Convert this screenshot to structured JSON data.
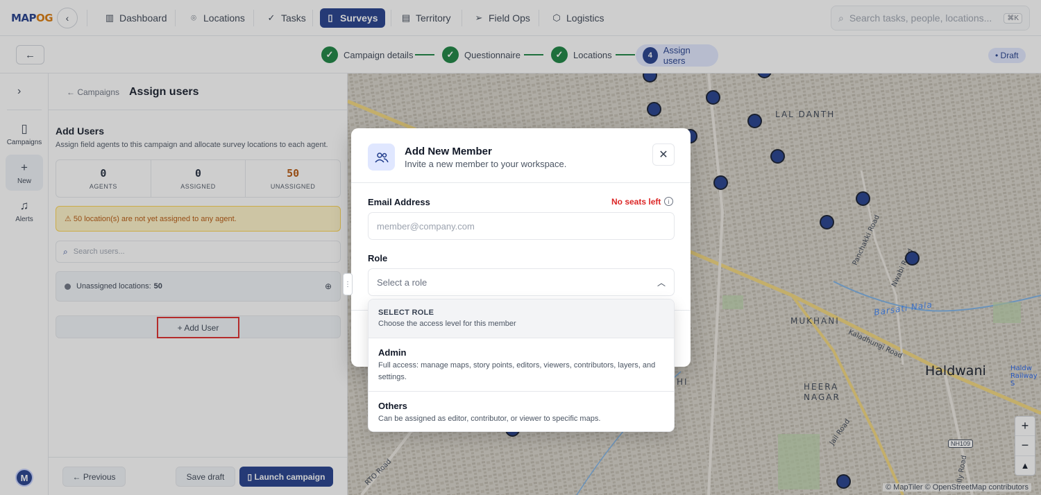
{
  "brand": {
    "logo_a": "MAP",
    "logo_b": "OG"
  },
  "nav": {
    "items": [
      {
        "label": "Dashboard",
        "icon": "bar-chart-icon"
      },
      {
        "label": "Locations",
        "icon": "map-pin-icon"
      },
      {
        "label": "Tasks",
        "icon": "check-icon"
      },
      {
        "label": "Surveys",
        "icon": "clipboard-icon",
        "active": true
      },
      {
        "label": "Territory",
        "icon": "map-icon"
      },
      {
        "label": "Field Ops",
        "icon": "send-icon"
      },
      {
        "label": "Logistics",
        "icon": "box-icon"
      }
    ],
    "search_placeholder": "Search tasks, people, locations...",
    "search_shortcut": "⌘K"
  },
  "steps": [
    {
      "label": "Campaign details",
      "done": true
    },
    {
      "label": "Questionnaire",
      "done": true
    },
    {
      "label": "Locations",
      "done": true
    },
    {
      "label": "Assign users",
      "number": "4",
      "current": true
    }
  ],
  "status_badge": "• Draft",
  "rail": {
    "items": [
      {
        "label": "Campaigns",
        "icon": "clipboard-icon"
      },
      {
        "label": "New",
        "icon": "plus-icon"
      },
      {
        "label": "Alerts",
        "icon": "bell-icon"
      }
    ],
    "avatar_initial": "M"
  },
  "panel": {
    "breadcrumb": "← Campaigns",
    "title": "Assign users",
    "section_title": "Add Users",
    "section_subtitle": "Assign field agents to this campaign and allocate survey locations to each agent.",
    "stats": [
      {
        "value": "0",
        "label": "AGENTS"
      },
      {
        "value": "0",
        "label": "ASSIGNED"
      },
      {
        "value": "50",
        "label": "UNASSIGNED",
        "warn": true
      }
    ],
    "warning": "⚠ 50 location(s) are not yet assigned to any agent.",
    "user_search_placeholder": "Search users...",
    "unassigned_label": "Unassigned locations:",
    "unassigned_count": "50",
    "add_user_label": "+ Add User",
    "prev_label": "← Previous",
    "save_label": "Save draft",
    "launch_label": "▯ Launch campaign"
  },
  "map": {
    "labels": {
      "lal_danth": "LAL DANTH",
      "mukhani": "MUKHANI",
      "heera": "HEERA",
      "nagar": "NAGAR",
      "haldwani": "Haldwani",
      "barsati": "Barsati Nala",
      "panchakki": "Panchakki Road",
      "nawabi": "Nwabi Road",
      "kaladhungi": "Kaladhungi Road",
      "rto": "RTO Road",
      "jail": "Jail Road",
      "nh": "NH109",
      "hi": "HI",
      "railway": "Haldw Railway S",
      "holly": "olly Road"
    },
    "attribution": "© MapTiler © OpenStreetMap contributors",
    "zoom_in": "+",
    "zoom_out": "−",
    "compass": "▲"
  },
  "modal": {
    "title": "Add New Member",
    "subtitle": "Invite a new member to your workspace.",
    "email_label": "Email Address",
    "seats_warning": "No seats left",
    "email_value": "",
    "email_placeholder": "member@company.com",
    "role_label": "Role",
    "role_placeholder": "Select a role",
    "dropdown": {
      "header_title": "SELECT ROLE",
      "header_subtitle": "Choose the access level for this member",
      "options": [
        {
          "label": "Admin",
          "description": "Full access: manage maps, story points, editors, viewers, contributors, layers, and settings."
        },
        {
          "label": "Others",
          "description": "Can be assigned as editor, contributor, or viewer to specific maps."
        }
      ]
    }
  },
  "colors": {
    "primary": "#1e3a8a",
    "success": "#15803d",
    "danger": "#dc2626",
    "warning": "#b45309"
  }
}
